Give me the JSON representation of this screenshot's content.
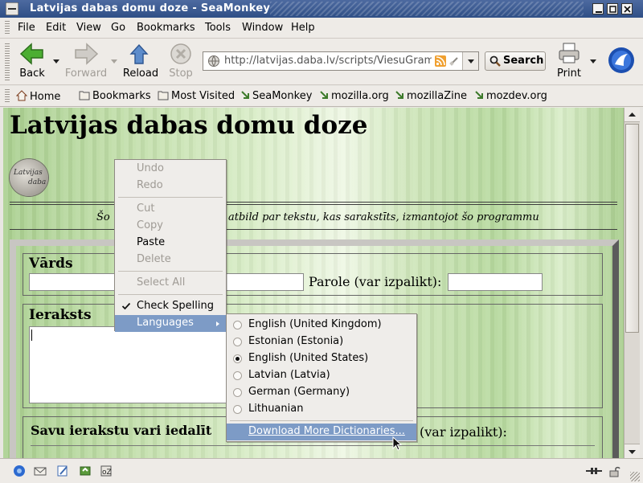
{
  "window": {
    "title": "Latvijas dabas domu doze - SeaMonkey"
  },
  "menubar": [
    {
      "label": "File"
    },
    {
      "label": "Edit"
    },
    {
      "label": "View"
    },
    {
      "label": "Go"
    },
    {
      "label": "Bookmarks"
    },
    {
      "label": "Tools"
    },
    {
      "label": "Window"
    },
    {
      "label": "Help"
    }
  ],
  "toolbar": {
    "back": "Back",
    "forward": "Forward",
    "reload": "Reload",
    "stop": "Stop",
    "url": "http://latvijas.daba.lv/scripts/ViesuGramata",
    "search": "Search",
    "print": "Print"
  },
  "bookmarks": [
    {
      "label": "Home"
    },
    {
      "label": "Bookmarks"
    },
    {
      "label": "Most Visited"
    },
    {
      "label": "SeaMonkey"
    },
    {
      "label": "mozilla.org"
    },
    {
      "label": "mozillaZine"
    },
    {
      "label": "mozdev.org"
    }
  ],
  "page": {
    "heading": "Latvijas dabas domu doze",
    "logo_line1": "Latvijas",
    "logo_line2": "daba",
    "notice_left": "Šo",
    "notice_right": "atbild par tekstu, kas sarakstīts, izmantojot šo programmu",
    "name_label": "Vārds",
    "password_label": "Parole (var izpalikt):",
    "entry_label": "Ieraksts",
    "share_label": "Savu ierakstu vari iedalīt",
    "share_optional": "(var izpalikt):"
  },
  "context_menu": {
    "items": [
      {
        "label": "Undo",
        "enabled": false
      },
      {
        "label": "Redo",
        "enabled": false
      },
      {
        "label": "Cut",
        "enabled": false
      },
      {
        "label": "Copy",
        "enabled": false
      },
      {
        "label": "Paste",
        "enabled": true
      },
      {
        "label": "Delete",
        "enabled": false
      },
      {
        "label": "Select All",
        "enabled": false
      },
      {
        "label": "Check Spelling",
        "checked": true
      },
      {
        "label": "Languages",
        "highlighted": true
      }
    ]
  },
  "languages_menu": {
    "items": [
      {
        "label": "English (United Kingdom)",
        "selected": false
      },
      {
        "label": "Estonian (Estonia)",
        "selected": false
      },
      {
        "label": "English (United States)",
        "selected": true
      },
      {
        "label": "Latvian (Latvia)",
        "selected": false
      },
      {
        "label": "German (Germany)",
        "selected": false
      },
      {
        "label": "Lithuanian",
        "selected": false
      }
    ],
    "download": "Download More Dictionaries..."
  },
  "colors": {
    "menu_highlight": "#7d9bc6",
    "title_bar": "#3a5a91",
    "page_green": "#b5d89c"
  }
}
